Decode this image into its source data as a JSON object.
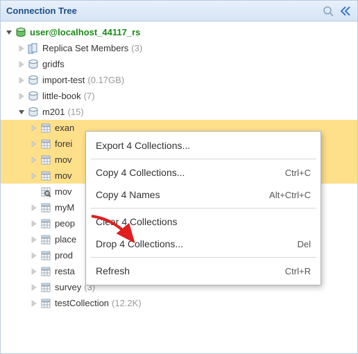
{
  "header": {
    "title": "Connection Tree"
  },
  "connection": {
    "label": "user@localhost_44117_rs"
  },
  "nodes": {
    "replica": {
      "label": "Replica Set Members",
      "count": "(3)"
    },
    "gridfs": {
      "label": "gridfs"
    },
    "importtest": {
      "label": "import-test",
      "count": "(0.17GB)"
    },
    "littlebook": {
      "label": "little-book",
      "count": "(7)"
    },
    "m201": {
      "label": "m201",
      "count": "(15)"
    },
    "c0": {
      "label": "exan"
    },
    "c1": {
      "label": "forei"
    },
    "c2": {
      "label": "mov"
    },
    "c3": {
      "label": "mov"
    },
    "c4": {
      "label": "mov"
    },
    "c5": {
      "label": "myM"
    },
    "c6": {
      "label": "peop"
    },
    "c7": {
      "label": "place"
    },
    "c8": {
      "label": "prod"
    },
    "c9": {
      "label": "resta"
    },
    "c10": {
      "label": "survey",
      "count": "(3)"
    },
    "c11": {
      "label": "testCollection",
      "count": "(12.2K)"
    }
  },
  "menu": {
    "export": "Export 4 Collections...",
    "copy": "Copy 4 Collections...",
    "copyShortcut": "Ctrl+C",
    "names": "Copy 4 Names",
    "namesShortcut": "Alt+Ctrl+C",
    "clear": "Clear 4 Collections",
    "drop": "Drop 4 Collections...",
    "dropShortcut": "Del",
    "refresh": "Refresh",
    "refreshShortcut": "Ctrl+R"
  }
}
